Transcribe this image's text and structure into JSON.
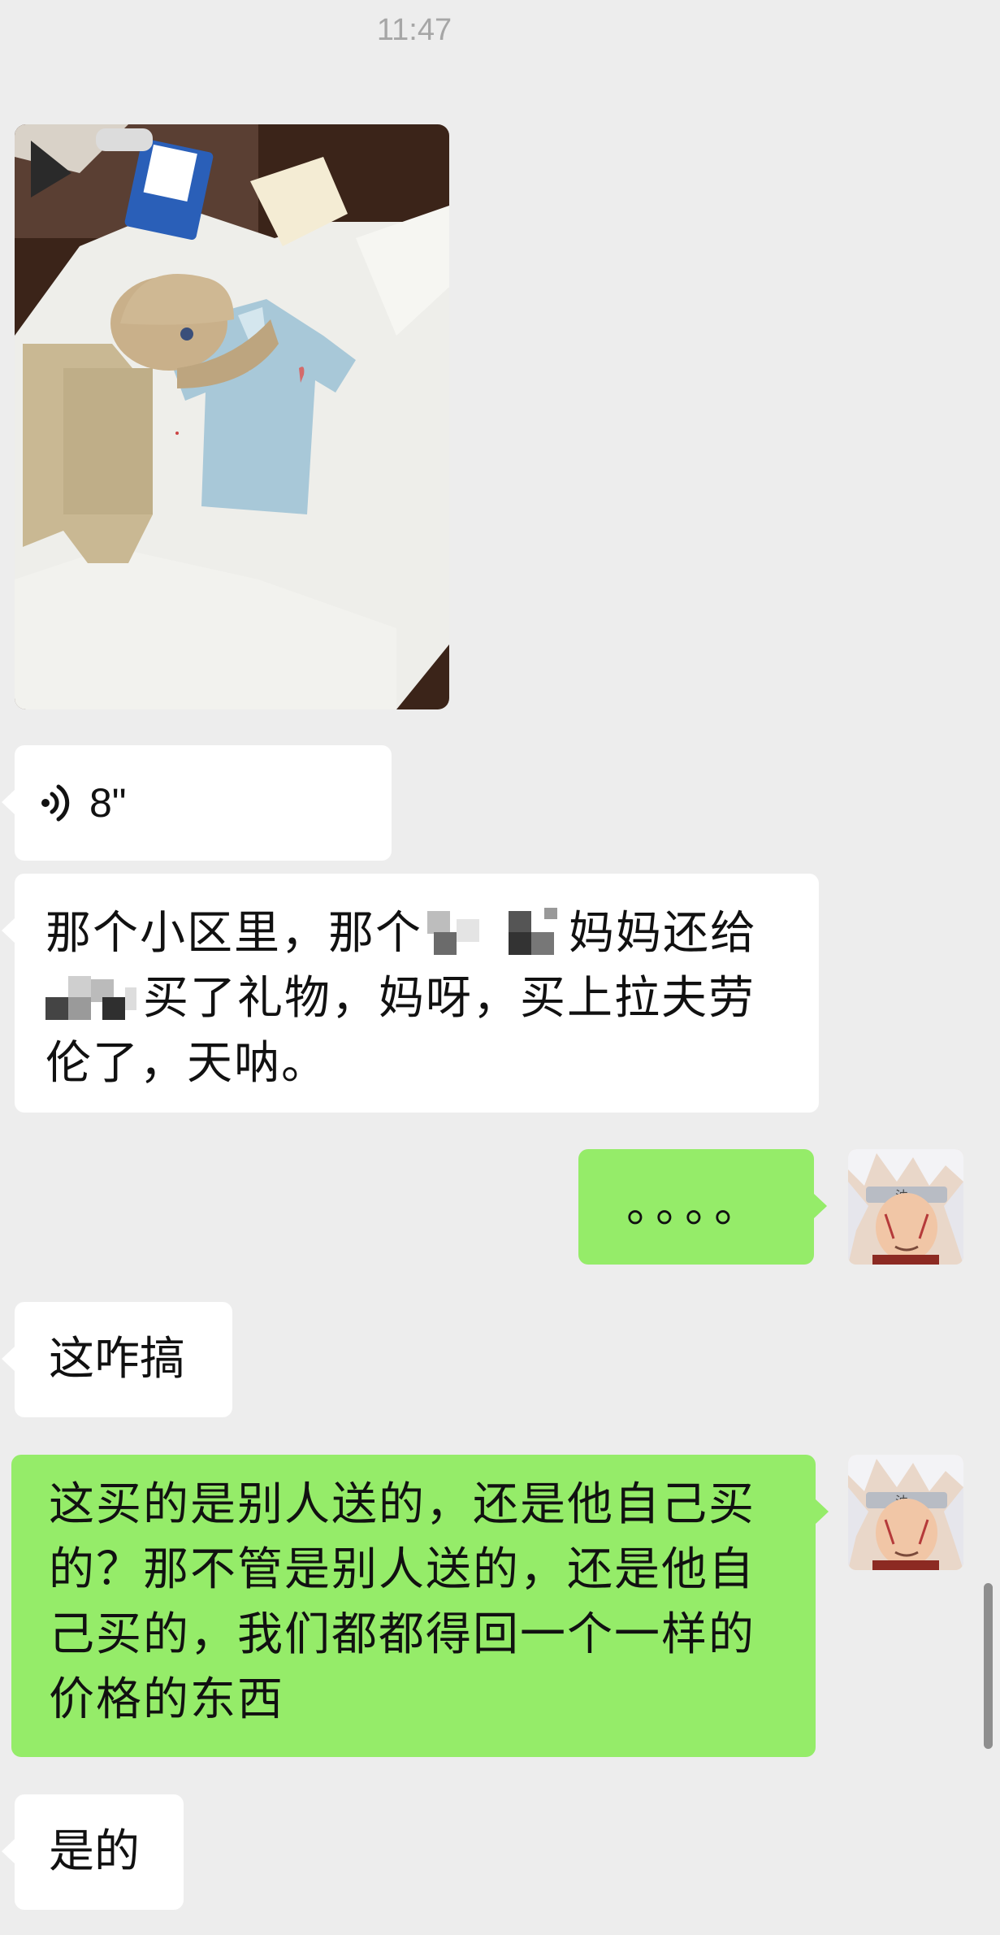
{
  "status": {
    "time": "11:47"
  },
  "chat": {
    "photo": {
      "icon": "photo-clothes-gift"
    },
    "voice": {
      "icon": "voice-wave-icon",
      "duration": "8\""
    },
    "msg1": {
      "line1_a": "那个小区里，那个",
      "line1_b": "妈妈还给",
      "line2_b": "买了礼物，妈呀，买上拉夫劳",
      "line3": "伦了，天呐。"
    },
    "dots": "。。。。",
    "msg2": "这咋搞",
    "msg3": {
      "line1": "这买的是别人送的，还是他自己买",
      "line2": "的？那不管是别人送的，还是他自",
      "line3": "己买的，我们都都得回一个一样的",
      "line4": "价格的东西"
    },
    "msg4": "是的"
  },
  "colors": {
    "background": "#ededed",
    "outgoing_bubble": "#95ec69",
    "incoming_bubble": "#ffffff"
  }
}
